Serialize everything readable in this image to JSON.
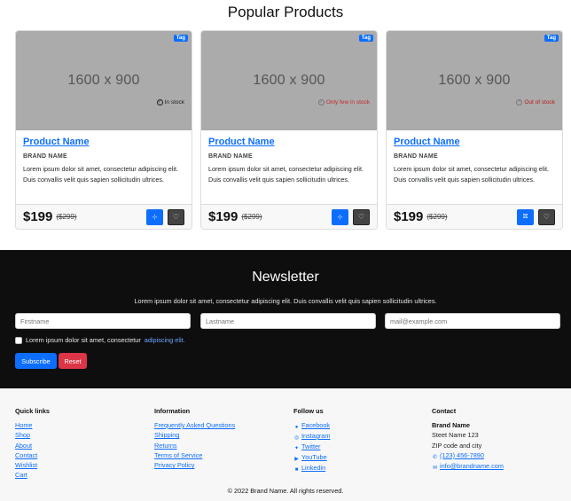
{
  "popular": {
    "title": "Popular Products",
    "products": [
      {
        "image_text": "1600 x 900",
        "tag": "Tag",
        "name": "Product Name",
        "brand": "BRAND NAME",
        "description": "Lorem ipsum dolor sit amet, consectetur adipiscing elit. Duis convallis velit quis sapien sollicitudin ultrices.",
        "stock": "In stock",
        "price": "$199",
        "old_price": "($299)"
      },
      {
        "image_text": "1600 x 900",
        "tag": "Tag",
        "name": "Product Name",
        "brand": "BRAND NAME",
        "description": "Lorem ipsum dolor sit amet, consectetur adipiscing elit. Duis convallis velit quis sapien sollicitudin ultrices.",
        "stock": "Only few in stock",
        "price": "$199",
        "old_price": "($299)"
      },
      {
        "image_text": "1600 x 900",
        "tag": "Tag",
        "name": "Product Name",
        "brand": "BRAND NAME",
        "description": "Lorem ipsum dolor sit amet, consectetur adipiscing elit. Duis convallis velit quis sapien sollicitudin ultrices.",
        "stock": "Out of stock",
        "price": "$199",
        "old_price": "($299)"
      }
    ]
  },
  "newsletter": {
    "title": "Newsletter",
    "description": "Lorem ipsum dolor sit amet, consectetur adipiscing elit. Duis convallis velit quis sapien sollicitudin ultrices.",
    "firstname_placeholder": "Firstname",
    "lastname_placeholder": "Lastname",
    "email_placeholder": "mail@example.com",
    "consent_text": "Lorem ipsum dolor sit amet, consectetur",
    "consent_link": "adipiscing elit.",
    "subscribe_label": "Subscribe",
    "reset_label": "Reset"
  },
  "footer": {
    "quick_links": {
      "title": "Quick links",
      "items": [
        "Home",
        "Shop",
        "About",
        "Contact",
        "Wishlist",
        "Cart"
      ]
    },
    "information": {
      "title": "Information",
      "items": [
        "Frequently Asked Questions",
        "Shipping",
        "Returns",
        "Terms of Service",
        "Privacy Policy"
      ]
    },
    "follow": {
      "title": "Follow us",
      "items": [
        "Facebook",
        "Instagram",
        "Twitter",
        "YouTube",
        "Linkedin"
      ]
    },
    "contact": {
      "title": "Contact",
      "brand": "Brand Name",
      "street": "Steet Name 123",
      "city": "ZIP code and city",
      "phone": "(123) 456-7890",
      "email": "info@brandname.com"
    },
    "copyright": "© 2022 Brand Name. All rights reserved."
  },
  "colors": {
    "primary": "#0d6efd",
    "danger": "#dc3545",
    "dark": "#0e0e0f",
    "placeholder_gray": "#ababab"
  }
}
